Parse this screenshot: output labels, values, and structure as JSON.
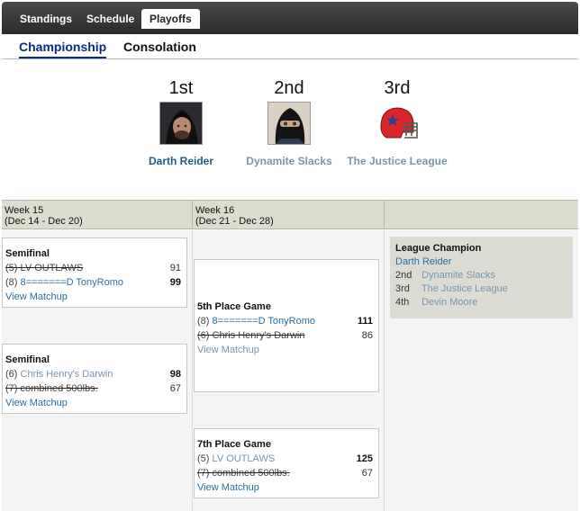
{
  "nav": {
    "tabs": [
      "Standings",
      "Schedule",
      "Playoffs"
    ],
    "active": "Playoffs"
  },
  "subnav": {
    "tabs": [
      "Championship",
      "Consolation"
    ],
    "active": "Championship"
  },
  "podium": [
    {
      "place": "1st",
      "name": "Darth Reider"
    },
    {
      "place": "2nd",
      "name": "Dynamite Slacks"
    },
    {
      "place": "3rd",
      "name": "The Justice League"
    }
  ],
  "weeks": [
    {
      "label": "Week 15",
      "dates": "(Dec 14 - Dec 20)"
    },
    {
      "label": "Week 16",
      "dates": "(Dec 21 - Dec 28)"
    },
    {
      "label": "",
      "dates": ""
    }
  ],
  "games": {
    "semi1": {
      "title": "Semifinal",
      "teams": [
        {
          "seed": "(5)",
          "name": "LV OUTLAWS",
          "score": "91"
        },
        {
          "seed": "(8)",
          "name": "8=======D TonyRomo",
          "score": "99"
        }
      ],
      "link": "View Matchup"
    },
    "semi2": {
      "title": "Semifinal",
      "teams": [
        {
          "seed": "(6)",
          "name": "Chris Henry's Darwin",
          "score": "98"
        },
        {
          "seed": "(7)",
          "name": "combined 500lbs.",
          "score": "67"
        }
      ],
      "link": "View Matchup"
    },
    "fifth": {
      "title": "5th Place Game",
      "teams": [
        {
          "seed": "(8)",
          "name": "8=======D TonyRomo",
          "score": "111"
        },
        {
          "seed": "(6)",
          "name": "Chris Henry's Darwin",
          "score": "86"
        }
      ],
      "link": "View Matchup"
    },
    "seventh": {
      "title": "7th Place Game",
      "teams": [
        {
          "seed": "(5)",
          "name": "LV OUTLAWS",
          "score": "125"
        },
        {
          "seed": "(7)",
          "name": "combined 500lbs.",
          "score": "67"
        }
      ],
      "link": "View Matchup"
    }
  },
  "champion_box": {
    "title": "League Champion",
    "champion": "Darth Reider",
    "places": [
      {
        "place": "2nd",
        "name": "Dynamite Slacks"
      },
      {
        "place": "3rd",
        "name": "The Justice League"
      },
      {
        "place": "4th",
        "name": "Devin Moore"
      }
    ]
  }
}
